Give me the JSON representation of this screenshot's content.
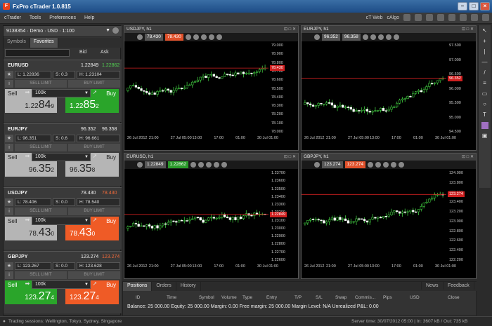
{
  "window": {
    "title": "FxPro cTrader 1.0.815"
  },
  "menu": [
    "cTrader",
    "Tools",
    "Preferences",
    "Help"
  ],
  "menu_right": [
    "cT Web",
    "cAlgo"
  ],
  "account": {
    "label": "9138354 · Demo · USD · 1:100"
  },
  "tabs": [
    "Symbols",
    "Favorites"
  ],
  "headers": {
    "bid": "Bid",
    "ask": "Ask"
  },
  "symbols": [
    {
      "name": "EURUSD",
      "bid": "1.22849",
      "ask": "1.22862",
      "ask_color": "#52d052",
      "low": "L: 1.22836",
      "spread": "S: 0.3",
      "high": "H: 1.23104",
      "sell_limit": "SELL LIMIT",
      "buy_limit": "BUY LIMIT",
      "volume": "100k",
      "sell_label": "Sell",
      "buy_label": "Buy",
      "sell_pre": "1.22",
      "sell_big": "84",
      "sell_post": "9",
      "buy_pre": "1.22",
      "buy_big": "85",
      "buy_post": "2",
      "sell_style": "grey",
      "buy_style": "green"
    },
    {
      "name": "EURJPY",
      "bid": "96.352",
      "ask": "96.358",
      "ask_color": "#eeeeee",
      "low": "L: 96.351",
      "spread": "S: 0.6",
      "high": "H: 96.661",
      "sell_limit": "SELL LIMIT",
      "buy_limit": "BUY LIMIT",
      "volume": "100k",
      "sell_label": "Sell",
      "buy_label": "Buy",
      "sell_pre": "96.",
      "sell_big": "35",
      "sell_post": "2",
      "buy_pre": "96.",
      "buy_big": "35",
      "buy_post": "8",
      "sell_style": "grey",
      "buy_style": "grey"
    },
    {
      "name": "USDJPY",
      "bid": "78.430",
      "ask": "78.430",
      "ask_color": "#f06a3a",
      "low": "L: 78.406",
      "spread": "S: 0.0",
      "high": "H: 78.540",
      "sell_limit": "SELL LIMIT",
      "buy_limit": "BUY LIMIT",
      "volume": "100k",
      "sell_label": "Sell",
      "buy_label": "Buy",
      "sell_pre": "78.",
      "sell_big": "43",
      "sell_post": "0",
      "buy_pre": "78.",
      "buy_big": "43",
      "buy_post": "0",
      "sell_style": "grey",
      "buy_style": "orange"
    },
    {
      "name": "GBPJPY",
      "bid": "123.274",
      "ask": "123.274",
      "ask_color": "#f06a3a",
      "low": "L: 123.267",
      "spread": "S: 0.0",
      "high": "H: 123.628",
      "sell_limit": "SELL LIMIT",
      "buy_limit": "BUY LIMIT",
      "volume": "100k",
      "sell_label": "Sell",
      "buy_label": "Buy",
      "sell_pre": "123.",
      "sell_big": "27",
      "sell_post": "4",
      "buy_pre": "123.",
      "buy_big": "27",
      "buy_post": "4",
      "sell_style": "green",
      "buy_style": "orange"
    }
  ],
  "charts": [
    {
      "title": "USDJPY, h1",
      "bid": "78.430",
      "ask": "78.430",
      "ask_style": "rd",
      "price_label": "78.430",
      "yticks": [
        "79.000",
        "78.900",
        "78.800",
        "78.700",
        "78.600",
        "78.500",
        "78.400",
        "78.300",
        "78.200",
        "78.100",
        "78.000"
      ],
      "xticks": [
        "26 Jul 2012",
        "21:00",
        "27 Jul 05:00",
        "13:00",
        "17:00",
        "01:00",
        "30 Jul 01:00"
      ]
    },
    {
      "title": "EURJPY, h1",
      "bid": "96.352",
      "ask": "96.358",
      "ask_style": "gr",
      "price_label": "96.352",
      "yticks": [
        "97.500",
        "97.000",
        "96.500",
        "96.000",
        "95.500",
        "95.000",
        "94.500"
      ],
      "xticks": [
        "26 Jul 2012",
        "21:00",
        "27 Jul 05:00",
        "13:00",
        "17:00",
        "01:00",
        "30 Jul 01:00"
      ]
    },
    {
      "title": "EURUSD, h1",
      "bid": "1.22849",
      "ask": "1.22862",
      "ask_style": "gn",
      "price_label": "1.22849",
      "yticks": [
        "1.23700",
        "1.23600",
        "1.23500",
        "1.23400",
        "1.23300",
        "1.23200",
        "1.23100",
        "1.23000",
        "1.22900",
        "1.22800",
        "1.22700",
        "1.22600"
      ],
      "xticks": [
        "26 Jul 2012",
        "21:00",
        "27 Jul 05:00",
        "13:00",
        "17:00",
        "01:00",
        "30 Jul 01:00"
      ]
    },
    {
      "title": "GBPJPY, h1",
      "bid": "123.274",
      "ask": "123.274",
      "ask_style": "rd",
      "price_label": "123.274",
      "yticks": [
        "124.000",
        "123.800",
        "123.600",
        "123.400",
        "123.200",
        "123.000",
        "122.800",
        "122.600",
        "122.400",
        "122.200"
      ],
      "xticks": [
        "26 Jul 2012",
        "21:00",
        "27 Jul 05:00",
        "13:00",
        "17:00",
        "01:00",
        "30 Jul 01:00"
      ]
    }
  ],
  "bottom": {
    "tabs": [
      "Positions",
      "Orders",
      "History"
    ],
    "tabs_right": [
      "News",
      "Feedback"
    ],
    "columns": [
      "ID",
      "Time",
      "Symbol",
      "Volume",
      "Type",
      "Entry",
      "T/P",
      "S/L",
      "Swap",
      "Commis...",
      "Pips",
      "USD",
      "Close"
    ],
    "balance": "Balance: 25 000.00   Equity: 25 000.00   Margin: 0.00   Free margin: 25 000.00   Margin Level: N/A   Unrealized P&L: 0.00"
  },
  "status": {
    "left": "Trading sessions: Wellington, Tokyo, Sydney, Singapore",
    "right": "Server time: 30/07/2012 05:00   |   In: 3607 kB / Out: 735 kB"
  }
}
